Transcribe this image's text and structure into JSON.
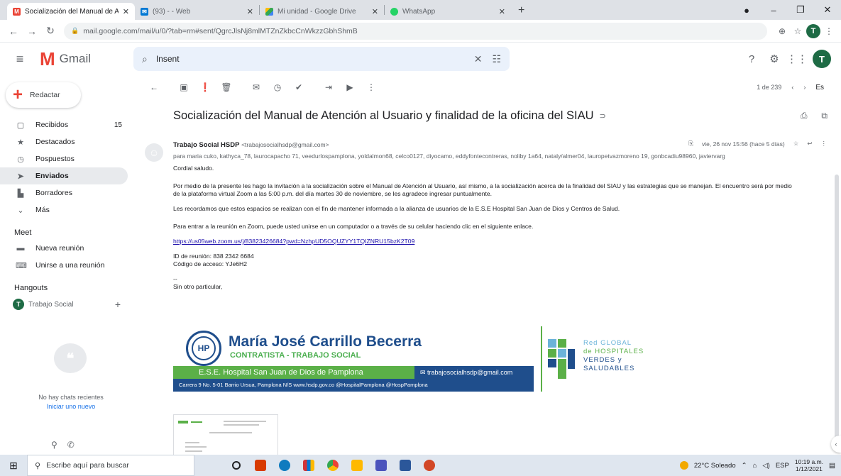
{
  "browser": {
    "tabs": [
      {
        "title": "Socialización del Manual de Aten",
        "favicon": "gmail-icon",
        "active": true
      },
      {
        "title": "(93) - - Web",
        "favicon": "mail-icon",
        "active": false
      },
      {
        "title": "Mi unidad - Google Drive",
        "favicon": "drive-icon",
        "active": false
      },
      {
        "title": "WhatsApp",
        "favicon": "whatsapp-icon",
        "active": false
      }
    ],
    "url": "mail.google.com/mail/u/0/?tab=rm#sent/QgrcJlsNj8mlMTZnZkbcCnWkzzGbhShmB"
  },
  "gmail": {
    "product": "Gmail",
    "search_value": "Insent",
    "compose_label": "Redactar",
    "nav": [
      {
        "label": "Recibidos",
        "icon": "inbox-icon",
        "count": "15",
        "selected": false
      },
      {
        "label": "Destacados",
        "icon": "star-icon",
        "count": "",
        "selected": false
      },
      {
        "label": "Pospuestos",
        "icon": "clock-icon",
        "count": "",
        "selected": false
      },
      {
        "label": "Enviados",
        "icon": "send-icon",
        "count": "",
        "selected": true
      },
      {
        "label": "Borradores",
        "icon": "draft-icon",
        "count": "",
        "selected": false
      },
      {
        "label": "Más",
        "icon": "chevron-down-icon",
        "count": "",
        "selected": false
      }
    ],
    "meet": {
      "title": "Meet",
      "items": [
        {
          "label": "Nueva reunión",
          "icon": "video-icon"
        },
        {
          "label": "Unirse a una reunión",
          "icon": "keyboard-icon"
        }
      ]
    },
    "hangouts": {
      "title": "Hangouts",
      "user": "Trabajo Social",
      "user_initial": "T",
      "no_chats": "No hay chats recientes",
      "start_new": "Iniciar uno nuevo"
    },
    "account_initial": "T"
  },
  "email": {
    "pager": "1 de 239",
    "lang": "Es",
    "subject": "Socialización del Manual de Atención al Usuario y finalidad de la oficina del SIAU",
    "sender_name": "Trabajo Social HSDP",
    "sender_email": "<trabajosocialhsdp@gmail.com>",
    "date": "vie, 26 nov 15:56 (hace 5 días)",
    "recipients": "para maria cuko, kathyca_78, laurocapacho 71, veedurlospamplona, yoldalmon68, celco0127, diyocamo, eddyfontecontreras, noliby 1a64, nataly/almer04, lauropetvazmoreno 19, gonbcadiu98960, javiervarg",
    "greeting": "Cordial saludo.",
    "para1": "Por medio de la presente les hago la invitación a la socialización sobre el Manual de Atención al Usuario, así mismo, a la socialización acerca de la finalidad del SIAU y las estrategias que se manejan. El encuentro será por medio de la plataforma virtual Zoom a las 5:00 p.m. del día martes 30 de noviembre, se les agradece ingresar puntualmente.",
    "para2": "Les recordamos que estos espacios se realizan con el fin de mantener informada a la alianza de usuarios de la E.S.E Hospital San Juan de Dios y Centros de Salud.",
    "para3": "Para entrar a la reunión en Zoom, puede usted unirse en un computador o a través de su celular haciendo clic en el siguiente enlace.",
    "link": "https://us05web.zoom.us/j/83823426684?pwd=NzhpUD5OQUZYY1TQIZNRU15bzK2T09",
    "meeting_id": "ID de reunión: 838 2342 6684",
    "passcode": "Código de acceso: YJe6H2",
    "dashes": "--",
    "closing": "Sin otro particular,"
  },
  "signature": {
    "name": "María José Carrillo Becerra",
    "role": "CONTRATISTA - TRABAJO SOCIAL",
    "hospital": "E.S.E. Hospital San Juan de Dios de Pamplona",
    "email": "trabajosocialhsdp@gmail.com",
    "contact": "Carrera 9 No. 5-01 Barrio Ursua, Pamplona N/S   www.hsdp.gov.co   @HospitalPamplona   @HospPamplona",
    "seal_text": "HP",
    "network": {
      "line1": "Red GLOBAL",
      "line2": "de HOSPITALES",
      "line3": "VERDES y",
      "line4": "SALUDABLES"
    },
    "colors": {
      "blue": "#1f4e8c",
      "green": "#5bb048",
      "light_blue": "#6bb3d9"
    }
  },
  "taskbar": {
    "search_placeholder": "Escribe aquí para buscar",
    "weather": "22°C  Soleado",
    "lang": "ESP",
    "time": "10:19 a.m.",
    "date": "1/12/2021"
  }
}
